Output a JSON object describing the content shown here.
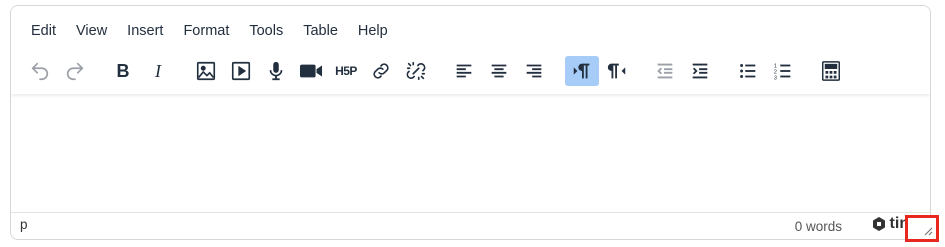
{
  "menubar": {
    "items": [
      "Edit",
      "View",
      "Insert",
      "Format",
      "Tools",
      "Table",
      "Help"
    ]
  },
  "toolbar": {
    "bold_label": "B",
    "italic_label": "I",
    "h5p_label": "H5P",
    "buttons": [
      {
        "name": "undo",
        "icon": "undo-icon",
        "state": "disabled"
      },
      {
        "name": "redo",
        "icon": "redo-icon",
        "state": "disabled"
      },
      {
        "name": "bold",
        "icon": "bold-icon"
      },
      {
        "name": "italic",
        "icon": "italic-icon"
      },
      {
        "name": "insert-image",
        "icon": "image-icon"
      },
      {
        "name": "insert-media",
        "icon": "media-play-icon"
      },
      {
        "name": "record-audio",
        "icon": "microphone-icon"
      },
      {
        "name": "record-video",
        "icon": "video-camera-icon"
      },
      {
        "name": "h5p",
        "icon": "h5p-icon"
      },
      {
        "name": "link",
        "icon": "link-icon"
      },
      {
        "name": "unlink",
        "icon": "unlink-icon"
      },
      {
        "name": "align-left",
        "icon": "align-left-icon"
      },
      {
        "name": "align-center",
        "icon": "align-center-icon"
      },
      {
        "name": "align-right",
        "icon": "align-right-icon"
      },
      {
        "name": "ltr",
        "icon": "ltr-icon",
        "state": "active"
      },
      {
        "name": "rtl",
        "icon": "rtl-icon"
      },
      {
        "name": "outdent",
        "icon": "outdent-icon",
        "state": "disabled"
      },
      {
        "name": "indent",
        "icon": "indent-icon"
      },
      {
        "name": "bullet-list",
        "icon": "bullet-list-icon"
      },
      {
        "name": "numbered-list",
        "icon": "numbered-list-icon"
      },
      {
        "name": "calculator",
        "icon": "calculator-icon"
      }
    ]
  },
  "statusbar": {
    "path": "p",
    "word_count": "0 words",
    "brand": "tiny"
  },
  "colors": {
    "active_bg": "#a6ccf7",
    "highlight_border": "#e8271f",
    "text": "#222f3e"
  }
}
